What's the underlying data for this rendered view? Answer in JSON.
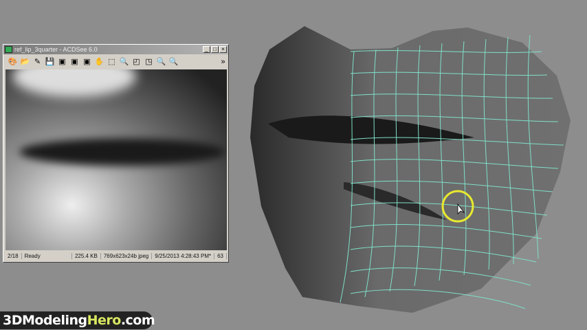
{
  "window": {
    "title": "ref_lip_3quarter - ACDSee 6.0",
    "controls": [
      "_",
      "□",
      "×"
    ]
  },
  "toolbar": {
    "icons": [
      "acquire-icon",
      "browse-icon",
      "edit-icon",
      "save-icon",
      "prev-image-icon",
      "next-image-icon",
      "slideshow-icon",
      "hand-icon",
      "select-icon",
      "zoom-icon",
      "rotate-left-icon",
      "rotate-right-icon",
      "zoom-out-icon",
      "zoom-in-icon"
    ],
    "more": "»"
  },
  "status": {
    "index": "2/18",
    "state": "Ready",
    "size": "225.4 KB",
    "dims": "769x623x24b jpeg",
    "date": "9/25/2013 4:28:43 PM*",
    "zoom": "63"
  },
  "logo": {
    "prefix": "3DModeling",
    "hero": "Hero",
    "suffix": ".com"
  },
  "colors": {
    "wire": "#7fe0c8",
    "cursor": "#e8e830"
  }
}
